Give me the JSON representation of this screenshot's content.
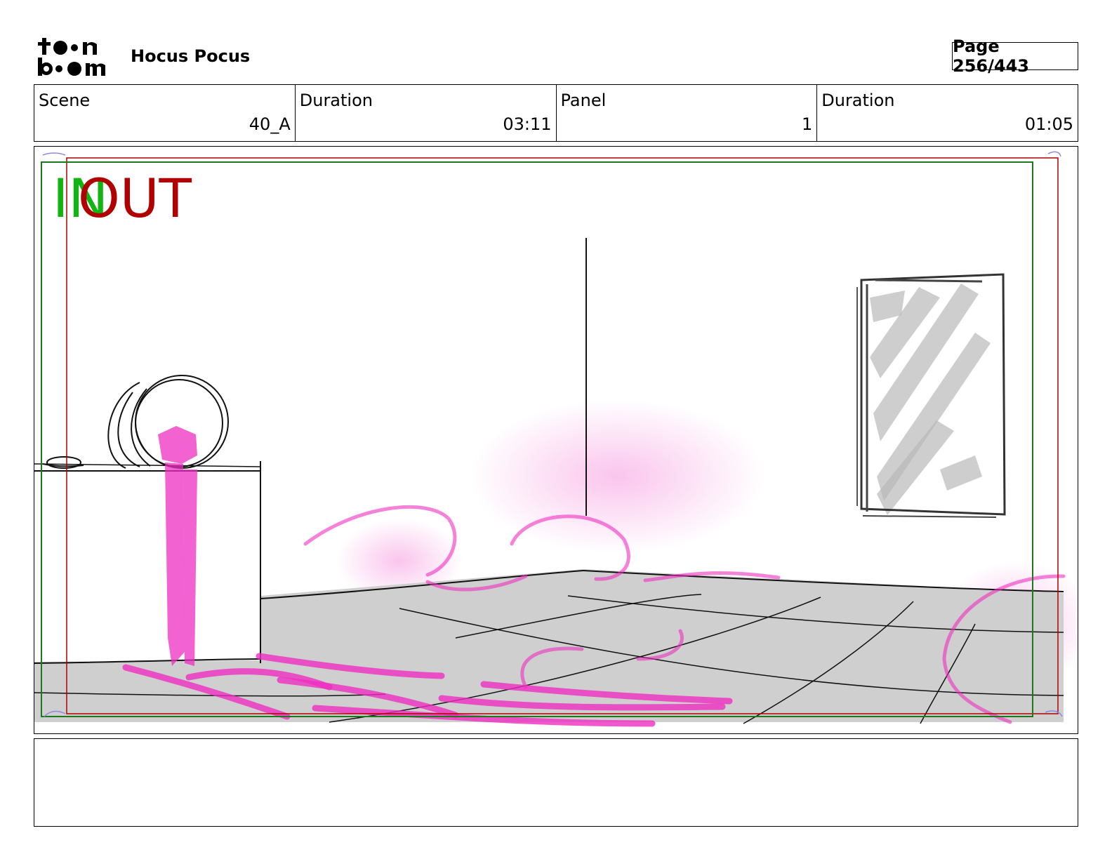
{
  "header": {
    "logo_text": "toon boom",
    "title": "Hocus Pocus",
    "page_label": "Page 256/443"
  },
  "info": {
    "scene_label": "Scene",
    "scene_value": "40_A",
    "scene_duration_label": "Duration",
    "scene_duration_value": "03:11",
    "panel_label": "Panel",
    "panel_value": "1",
    "panel_duration_label": "Duration",
    "panel_duration_value": "01:05"
  },
  "panel": {
    "in_label": "IN",
    "out_label": "OUT",
    "in_color": "#12b412",
    "out_color": "#b00000",
    "magic_color": "#ee2ec0"
  },
  "notes": {
    "text": ""
  }
}
